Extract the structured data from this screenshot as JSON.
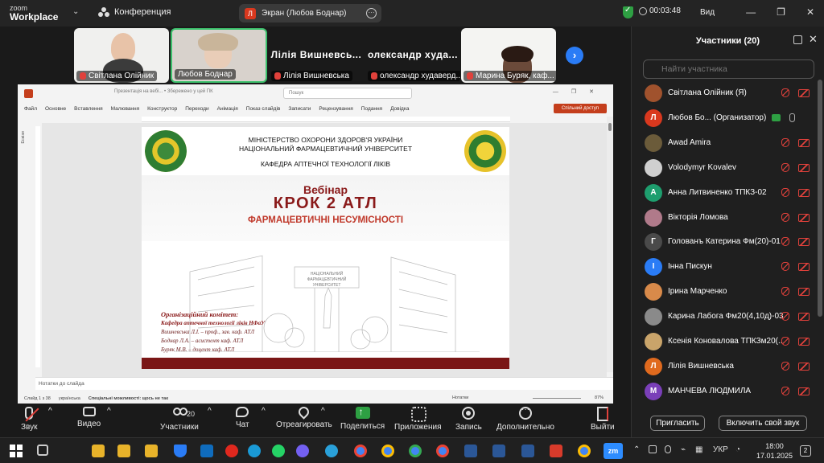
{
  "app": {
    "logo_line1": "zoom",
    "logo_line2": "Workplace",
    "meeting_label": "Конференция",
    "share_avatar": "Л",
    "share_label": "Экран (Любов Боднар)",
    "timer": "00:03:48",
    "view_label": "Вид"
  },
  "video_strip": {
    "tiles": [
      {
        "name": "Світлана Олійник",
        "muted": true,
        "has_video": true
      },
      {
        "name": "Любов Боднар",
        "muted": false,
        "has_video": true,
        "active": true
      },
      {
        "name": "Лілія Вишневська",
        "big_label": "Лілія Вишневсь...",
        "muted": true,
        "has_video": false
      },
      {
        "name": "олександр худаверд...",
        "big_label": "олександр худа...",
        "muted": true,
        "has_video": false
      },
      {
        "name": "Марина Буряк, каф...",
        "muted": true,
        "has_video": true
      }
    ],
    "next_icon": "›"
  },
  "powerpoint": {
    "title_text": "Презентація на вебі... • Збережено у цей ПК",
    "search_placeholder": "Пошук",
    "menu": [
      "Файл",
      "Основне",
      "Вставлення",
      "Малювання",
      "Конструктор",
      "Переходи",
      "Анімація",
      "Показ слайдів",
      "Записати",
      "Рецензування",
      "Подання",
      "Довідка"
    ],
    "share_button": "Спільний доступ",
    "left_label": "Ескізи",
    "notes_label": "Нотатки до слайда",
    "status_slide": "Слайд 1 з 38",
    "status_lang": "українська",
    "status_accessibility": "Спеціальні можливості: щось не так",
    "status_notes": "Нотатки",
    "status_zoom": "87%"
  },
  "slide": {
    "ministry_line1": "МІНІСТЕРСТВО ОХОРОНИ ЗДОРОВ'Я УКРАЇНИ",
    "ministry_line2": "НАЦІОНАЛЬНИЙ ФАРМАЦЕВТИЧНИЙ УНІВЕРСИТЕТ",
    "department": "КАФЕДРА АПТЕЧНОЇ ТЕХНОЛОГІЇ ЛІКІВ",
    "webinar": "Вебінар",
    "krok": "КРОК 2 АТЛ",
    "subtitle": "ФАРМАЦЕВТИЧНІ НЕСУМІСНОСТІ",
    "sketch_sign": "НАЦІОНАЛЬНИЙ ФАРМАЦЕВТИЧНИЙ УНІВЕРСИТЕТ",
    "committee_title": "Організаційний комітет:",
    "committee_dept": "Кафедра аптечної технології ліків НФаУ",
    "committee_members": [
      "Вишневська Л.І. – проф., зав. каф. АТЛ",
      "Боднар Л.А. – асистент каф. АТЛ",
      "Буряк М.В. – доцент каф. АТЛ"
    ]
  },
  "participants": {
    "title": "Участники (20)",
    "search_placeholder": "Найти участника",
    "items": [
      {
        "name": "Світлана Олійник (Я)",
        "avatar": "",
        "color": "#a0522d",
        "photo": true
      },
      {
        "name": "Любов Бо...  (Организатор)",
        "avatar": "Л",
        "color": "#d9381e",
        "host": true
      },
      {
        "name": "Awad Amira",
        "avatar": "",
        "color": "#6b5b3a",
        "photo": true
      },
      {
        "name": "Volodymyr Kovalev",
        "avatar": "",
        "color": "#cfcfcf",
        "photo": true
      },
      {
        "name": "Анна Литвиненко ТПКЗ-02",
        "avatar": "А",
        "color": "#1e9e6e"
      },
      {
        "name": "Вікторія Ломова",
        "avatar": "",
        "color": "#b07a8a",
        "photo": true
      },
      {
        "name": "Голованъ Катерина Фм(20)-01",
        "avatar": "Г",
        "color": "#4a4a4a"
      },
      {
        "name": "Інна Пискун",
        "avatar": "І",
        "color": "#2a7cf6"
      },
      {
        "name": "Ірина Марченко",
        "avatar": "",
        "color": "#d88a4a",
        "photo": true
      },
      {
        "name": "Карина Лабога Фм20(4,10д)-03",
        "avatar": "",
        "color": "#8a8a8a",
        "photo": true
      },
      {
        "name": "Ксенія Коновалова ТПКЗм20(...",
        "avatar": "",
        "color": "#c9a46a",
        "photo": true
      },
      {
        "name": "Лілія Вишневська",
        "avatar": "Л",
        "color": "#e06a1e"
      },
      {
        "name": "МАНЧЕВА ЛЮДМИЛА",
        "avatar": "М",
        "color": "#7a3fb8"
      }
    ],
    "invite_button": "Пригласить",
    "unmute_all_button": "Включить свой звук"
  },
  "toolbar": {
    "audio": "Звук",
    "video": "Видео",
    "participants": "Участники",
    "participants_count": "20",
    "chat": "Чат",
    "react": "Отреагировать",
    "share": "Поделиться",
    "apps": "Приложения",
    "record": "Запись",
    "more": "Дополнительно",
    "leave": "Выйти"
  },
  "taskbar": {
    "lang": "УКР",
    "time": "18:00",
    "date": "17.01.2025",
    "notifications": "2",
    "zm_label": "zm"
  },
  "colors": {
    "zoom_blue": "#2a7cf6",
    "zoom_green": "#2ea043",
    "mute_red": "#e0413b",
    "slide_maroon": "#7a1616"
  }
}
